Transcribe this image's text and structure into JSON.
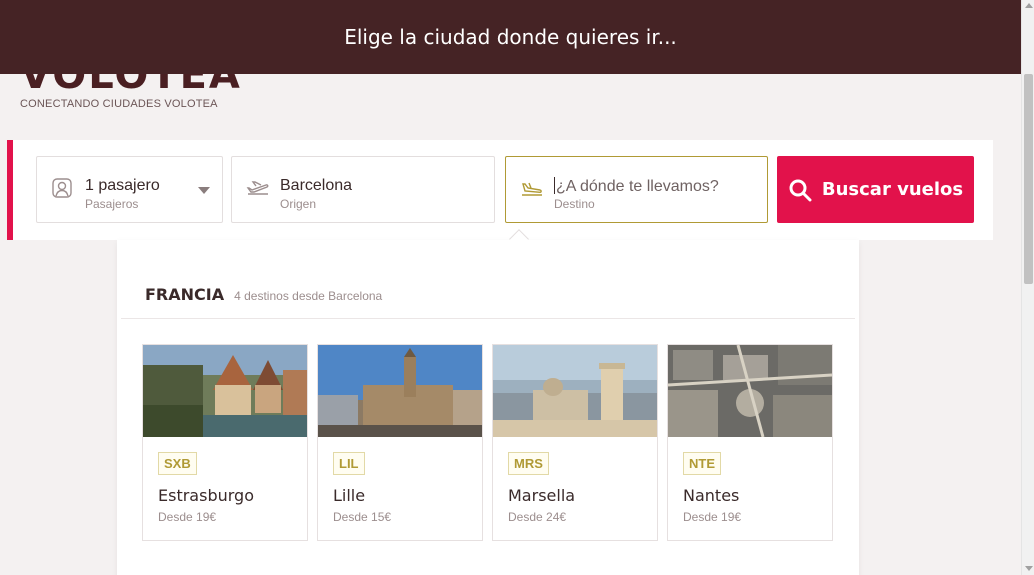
{
  "brand": {
    "logo_text": "VOLOTEA",
    "tagline": "CONECTANDO CIUDADES VOLOTEA"
  },
  "topbar": {
    "message": "Elige la ciudad donde quieres ir..."
  },
  "search": {
    "passengers": {
      "value": "1 pasajero",
      "label": "Pasajeros",
      "icon": "person-icon"
    },
    "origin": {
      "value": "Barcelona",
      "label": "Origen",
      "icon": "plane-takeoff-icon"
    },
    "destination": {
      "placeholder": "¿A dónde te llevamos?",
      "label": "Destino",
      "icon": "plane-landing-icon"
    },
    "button_label": "Buscar vuelos",
    "button_icon": "search-icon"
  },
  "dropdown": {
    "region": "FRANCIA",
    "region_sub": "4 destinos desde Barcelona",
    "destinations": [
      {
        "code": "SXB",
        "city": "Estrasburgo",
        "price": "Desde 19€"
      },
      {
        "code": "LIL",
        "city": "Lille",
        "price": "Desde 15€"
      },
      {
        "code": "MRS",
        "city": "Marsella",
        "price": "Desde 24€"
      },
      {
        "code": "NTE",
        "city": "Nantes",
        "price": "Desde 19€"
      }
    ]
  },
  "colors": {
    "topbar": "#452325",
    "accent": "#e2124b",
    "gold": "#b09a35"
  }
}
